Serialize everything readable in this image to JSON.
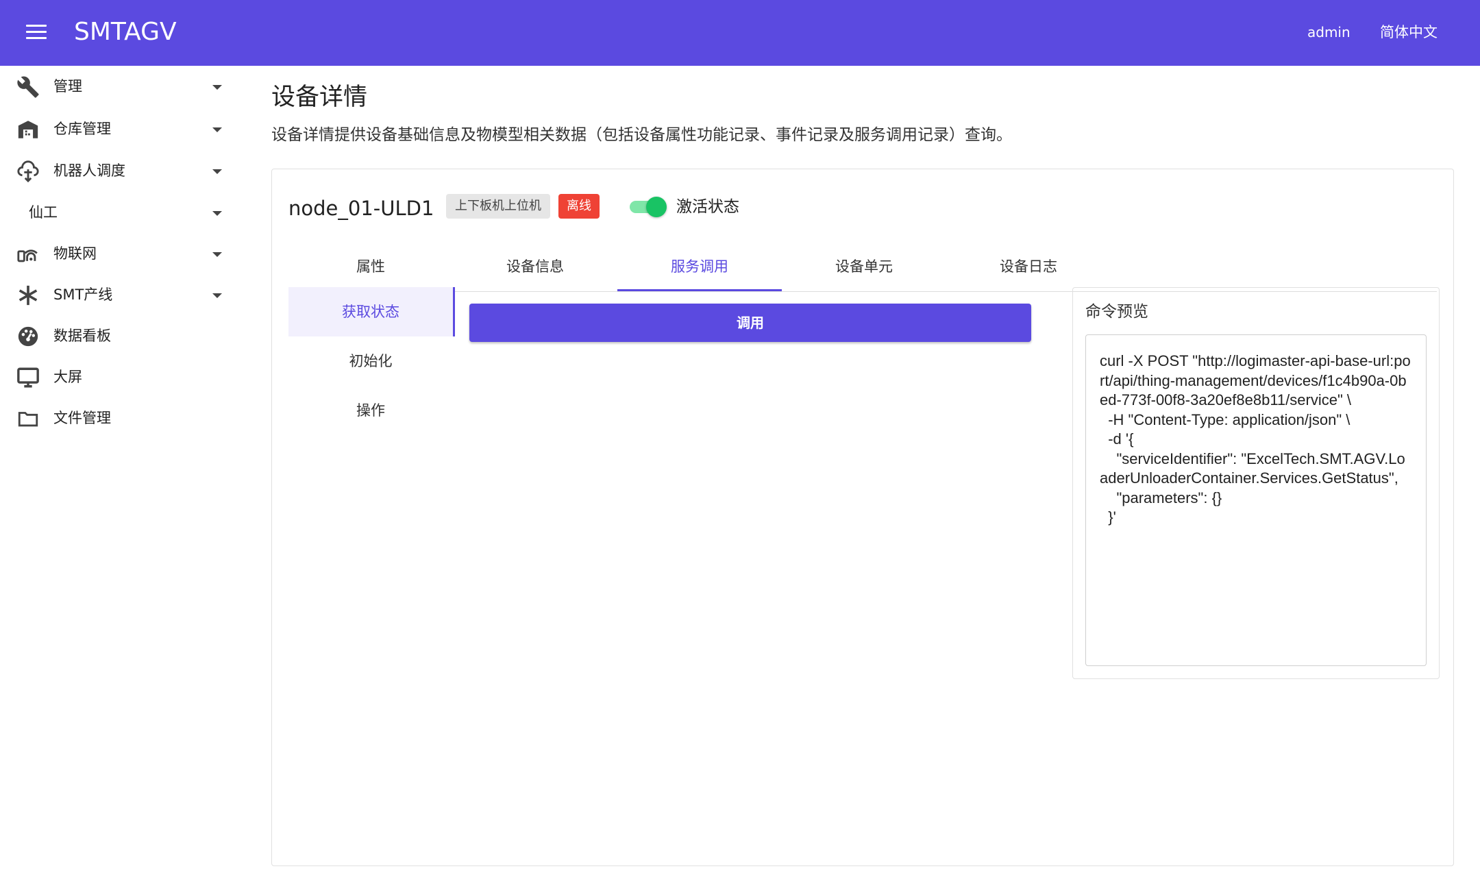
{
  "header": {
    "app_title": "SMTAGV",
    "user": "admin",
    "language": "简体中文",
    "menu_icon": "hamburger-menu-icon"
  },
  "sidebar": {
    "items": [
      {
        "label": "管理",
        "icon": "wrench-icon",
        "expandable": true
      },
      {
        "label": "仓库管理",
        "icon": "warehouse-icon",
        "expandable": true
      },
      {
        "label": "机器人调度",
        "icon": "robot-dispatch-icon",
        "expandable": true
      },
      {
        "label": "仙工",
        "icon": "",
        "expandable": true
      },
      {
        "label": "物联网",
        "icon": "iot-icon",
        "expandable": true
      },
      {
        "label": "SMT产线",
        "icon": "asterisk-icon",
        "expandable": true
      },
      {
        "label": "数据看板",
        "icon": "dashboard-icon",
        "expandable": false
      },
      {
        "label": "大屏",
        "icon": "monitor-icon",
        "expandable": false
      },
      {
        "label": "文件管理",
        "icon": "folder-icon",
        "expandable": false
      }
    ]
  },
  "page": {
    "title": "设备详情",
    "description": "设备详情提供设备基础信息及物模型相关数据（包括设备属性功能记录、事件记录及服务调用记录）查询。"
  },
  "device": {
    "name": "node_01-ULD1",
    "type_chip": "上下板机上位机",
    "status_chip": "离线",
    "active_label": "激活状态",
    "active": true
  },
  "tabs": [
    {
      "label": "属性",
      "active": false
    },
    {
      "label": "设备信息",
      "active": false
    },
    {
      "label": "服务调用",
      "active": true
    },
    {
      "label": "设备单元",
      "active": false
    },
    {
      "label": "设备日志",
      "active": false
    }
  ],
  "services": [
    {
      "label": "获取状态",
      "active": true
    },
    {
      "label": "初始化",
      "active": false
    },
    {
      "label": "操作",
      "active": false
    }
  ],
  "invoke_button": "调用",
  "command_preview": {
    "title": "命令预览",
    "text": "curl -X POST \"http://logimaster-api-base-url:port/api/thing-management/devices/f1c4b90a-0bed-773f-00f8-3a20ef8e8b11/service\" \\\n  -H \"Content-Type: application/json\" \\\n  -d '{\n    \"serviceIdentifier\": \"ExcelTech.SMT.AGV.LoaderUnloaderContainer.Services.GetStatus\",\n    \"parameters\": {}\n  }'"
  },
  "colors": {
    "primary": "#5b4ae0",
    "offline": "#ef4235",
    "toggle_on": "#19c364"
  }
}
